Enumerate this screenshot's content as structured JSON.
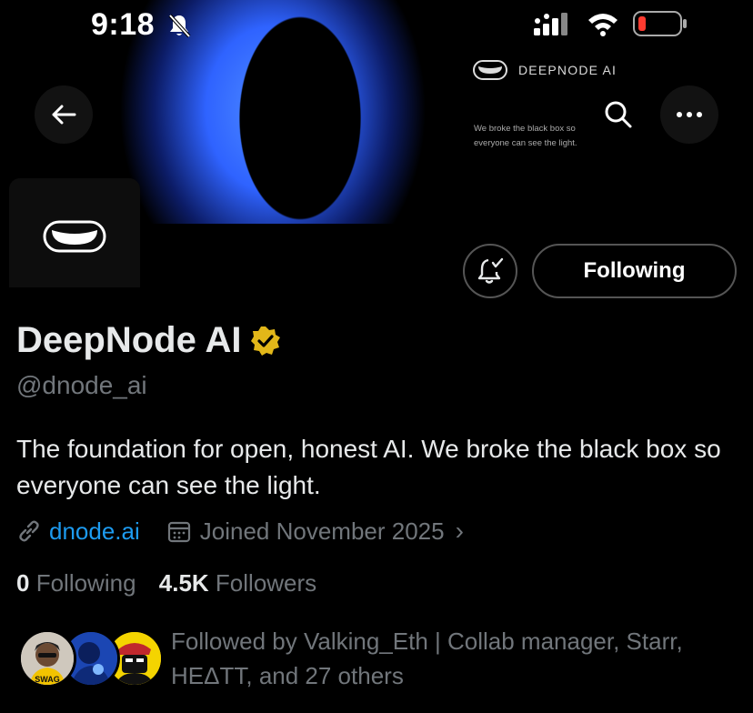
{
  "status_bar": {
    "time": "9:18",
    "icons": [
      "bell-slash-icon",
      "cellular-signal-icon",
      "wifi-icon",
      "battery-low-icon"
    ]
  },
  "banner": {
    "brand_name": "DEEPNODE AI",
    "tagline": "We broke the black box so everyone can see the light."
  },
  "nav": {
    "icons": [
      "back-arrow-icon",
      "search-icon",
      "more-dots-icon"
    ]
  },
  "actions": {
    "follow_label": "Following",
    "notify_icon": "bell-check-icon"
  },
  "profile": {
    "display_name": "DeepNode AI",
    "verified": true,
    "handle": "@dnode_ai",
    "bio": "The foundation for open, honest AI. We broke the black box so everyone can see the light.",
    "website": "dnode.ai",
    "joined": "Joined November 2025",
    "following_count": "0",
    "following_label": "Following",
    "followers_count": "4.5K",
    "followers_label": "Followers"
  },
  "followed_by": {
    "text": "Followed by Valking_Eth | Collab manager, Starr, HEΔTT, and 27 others",
    "avatar_badge": "SWAG"
  },
  "colors": {
    "background": "#000000",
    "accent_link": "#1d9bf0",
    "muted_text": "#71767b",
    "primary_text": "#e7e9ea",
    "verified_badge": "#e2b719",
    "battery_low": "#ff3b30"
  }
}
